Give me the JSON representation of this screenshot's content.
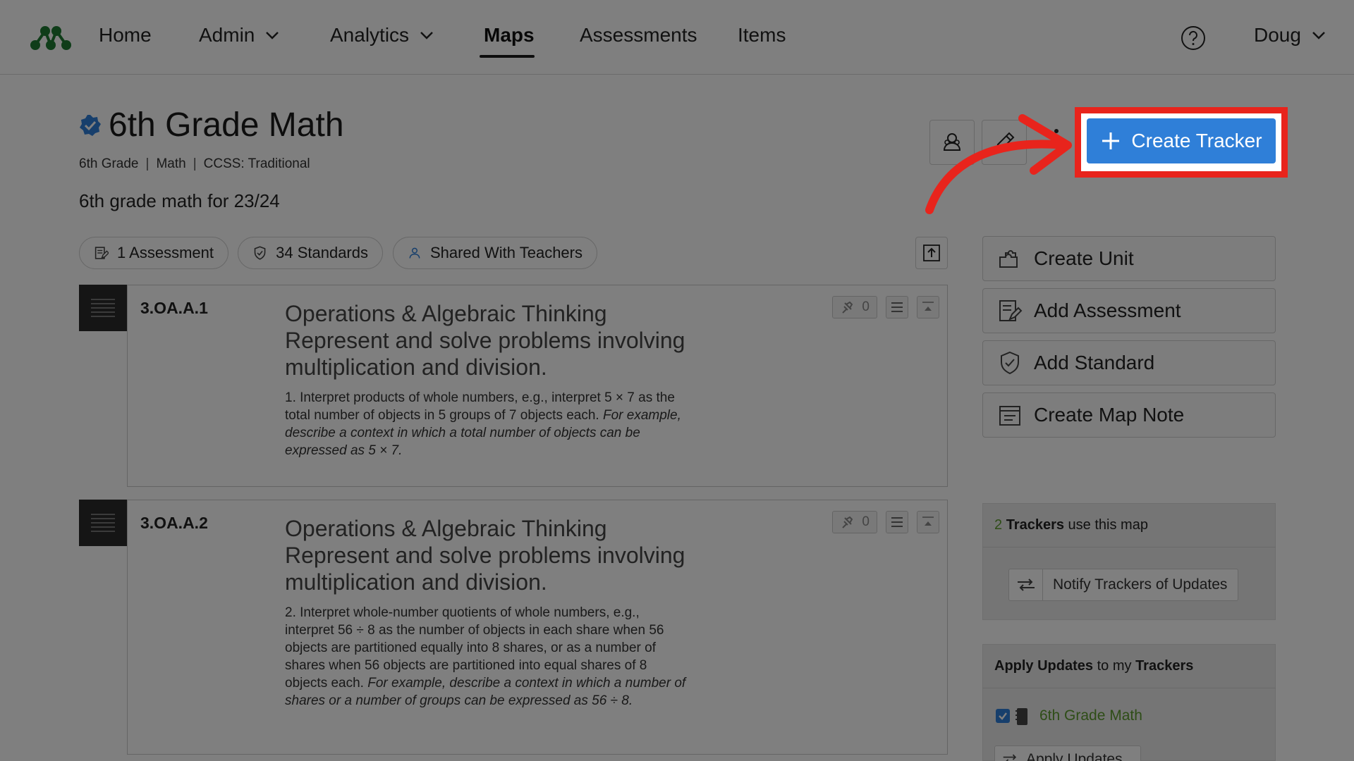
{
  "nav": {
    "items": [
      {
        "label": "Home",
        "dropdown": false
      },
      {
        "label": "Admin",
        "dropdown": true
      },
      {
        "label": "Analytics",
        "dropdown": true
      },
      {
        "label": "Maps",
        "dropdown": false,
        "active": true
      },
      {
        "label": "Assessments",
        "dropdown": false
      },
      {
        "label": "Items",
        "dropdown": false
      }
    ],
    "user": "Doug",
    "help_icon": "question-circle-icon"
  },
  "map": {
    "title": "6th Grade Math",
    "meta": [
      "6th Grade",
      "Math",
      "CCSS: Traditional"
    ],
    "meta_separator": "|",
    "description": "6th grade math for 23/24",
    "create_tracker_label": "Create Tracker"
  },
  "pills": {
    "assessments": "1 Assessment",
    "standards": "34 Standards",
    "shared": "Shared With Teachers"
  },
  "standards": [
    {
      "code": "3.OA.A.1",
      "title": "Operations & Algebraic Thinking Represent and solve problems involving multiplication and division.",
      "body": "1. Interpret products of whole numbers, e.g., interpret 5 × 7 as the total number of objects in 5 groups of 7 objects each.",
      "example": "For example, describe a context in which a total number of objects can be expressed as 5 × 7.",
      "pin_count": "0"
    },
    {
      "code": "3.OA.A.2",
      "title": "Operations & Algebraic Thinking Represent and solve problems involving multiplication and division.",
      "body": "2. Interpret whole-number quotients of whole numbers, e.g., interpret 56 ÷ 8 as the number of objects in each share when 56 objects are partitioned equally into 8 shares, or as a number of shares when 56 objects are partitioned into equal shares of 8 objects each.",
      "example": "For example, describe a context in which a number of shares or a number of groups can be expressed as 56 ÷ 8.",
      "pin_count": "0"
    }
  ],
  "actions": {
    "create_unit": "Create Unit",
    "add_assessment": "Add Assessment",
    "add_standard": "Add Standard",
    "create_map_note": "Create Map Note"
  },
  "trackers_panel": {
    "count": "2",
    "bold": "Trackers",
    "rest": "use this map",
    "notify_label": "Notify Trackers of Updates"
  },
  "apply_panel": {
    "bold1": "Apply Updates",
    "mid": "to my",
    "bold2": "Trackers",
    "tracker_name": "6th Grade Math",
    "tracker_checked": true,
    "apply_label": "Apply Updates"
  },
  "colors": {
    "accent": "#2f7fd8",
    "highlight": "#e8241c",
    "link_green": "#5d9b2f"
  }
}
